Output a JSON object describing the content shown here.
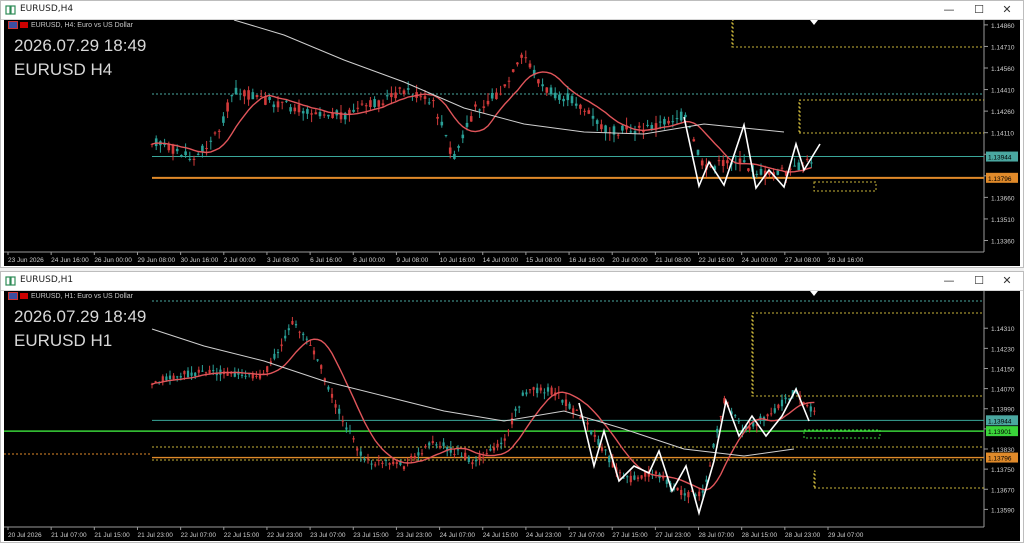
{
  "windows": [
    {
      "id": "h4",
      "title": "EURUSD,H4",
      "symbol_desc": "EURUSD, H4:  Euro vs US Dollar",
      "overlay_time": "2026.07.29 18:49",
      "overlay_sym": "EURUSD H4",
      "price_axis": {
        "min": 1.1328,
        "max": 1.1488,
        "ticks": [
          "1.14860",
          "1.14710",
          "1.14560",
          "1.14410",
          "1.14260",
          "1.14110",
          "1.13960",
          "1.13810",
          "1.13660",
          "1.13510",
          "1.13360"
        ],
        "tick_values": [
          1.1486,
          1.1471,
          1.1456,
          1.1441,
          1.1426,
          1.1411,
          1.1396,
          1.1381,
          1.1366,
          1.1351,
          1.1336
        ]
      },
      "price_tags": [
        {
          "text": "1.13944",
          "value": 1.13944,
          "color": "#4aa7a0"
        },
        {
          "text": "1.13796",
          "value": 1.13796,
          "color": "#e08a2a"
        }
      ],
      "time_labels": [
        "23 Jun 2026",
        "24 Jun 16:00",
        "26 Jun 00:00",
        "29 Jun 08:00",
        "30 Jun 16:00",
        "2 Jul 00:00",
        "3 Jul 08:00",
        "6 Jul 16:00",
        "8 Jul 00:00",
        "9 Jul 08:00",
        "10 Jul 16:00",
        "14 Jul 00:00",
        "15 Jul 08:00",
        "16 Jul 16:00",
        "20 Jul 00:00",
        "21 Jul 08:00",
        "22 Jul 16:00",
        "24 Jul 00:00",
        "27 Jul 08:00",
        "28 Jul 16:00"
      ]
    },
    {
      "id": "h1",
      "title": "EURUSD,H1",
      "symbol_desc": "EURUSD, H1:  Euro vs US Dollar",
      "overlay_time": "2026.07.29 18:49",
      "overlay_sym": "EURUSD H1",
      "price_axis": {
        "min": 1.1352,
        "max": 1.1445,
        "ticks": [
          "1.14310",
          "1.14230",
          "1.14150",
          "1.14070",
          "1.13990",
          "1.13910",
          "1.13830",
          "1.13750",
          "1.13670",
          "1.13590"
        ],
        "tick_values": [
          1.1431,
          1.1423,
          1.1415,
          1.1407,
          1.1399,
          1.1391,
          1.1383,
          1.1375,
          1.1367,
          1.1359
        ]
      },
      "price_tags": [
        {
          "text": "1.13944",
          "value": 1.13944,
          "color": "#4aa7a0"
        },
        {
          "text": "1.13901",
          "value": 1.13901,
          "color": "#3ad43a"
        },
        {
          "text": "1.13796",
          "value": 1.13796,
          "color": "#e08a2a"
        }
      ],
      "time_labels": [
        "20 Jul 2026",
        "21 Jul 07:00",
        "21 Jul 15:00",
        "21 Jul 23:00",
        "22 Jul 07:00",
        "22 Jul 15:00",
        "22 Jul 23:00",
        "23 Jul 07:00",
        "23 Jul 15:00",
        "23 Jul 23:00",
        "24 Jul 07:00",
        "24 Jul 15:00",
        "24 Jul 23:00",
        "27 Jul 07:00",
        "27 Jul 15:00",
        "27 Jul 23:00",
        "28 Jul 07:00",
        "28 Jul 15:00",
        "28 Jul 23:00",
        "29 Jul 07:00"
      ]
    }
  ],
  "colors": {
    "bull": "#2aa198",
    "bear": "#d23a3a",
    "ma_fast": "#e0555a",
    "ma_slow": "#d0d0d0",
    "zigzag": "#ffffff",
    "hline_teal": "#3aa79a",
    "hline_orange": "#e08a2a",
    "hline_green": "#3ad43a",
    "zone_yellow": "#c8b43a",
    "dotted_cyan": "#4aa7a0"
  },
  "controls": {
    "minimize": "—",
    "maximize": "☐",
    "close": "✕"
  }
}
